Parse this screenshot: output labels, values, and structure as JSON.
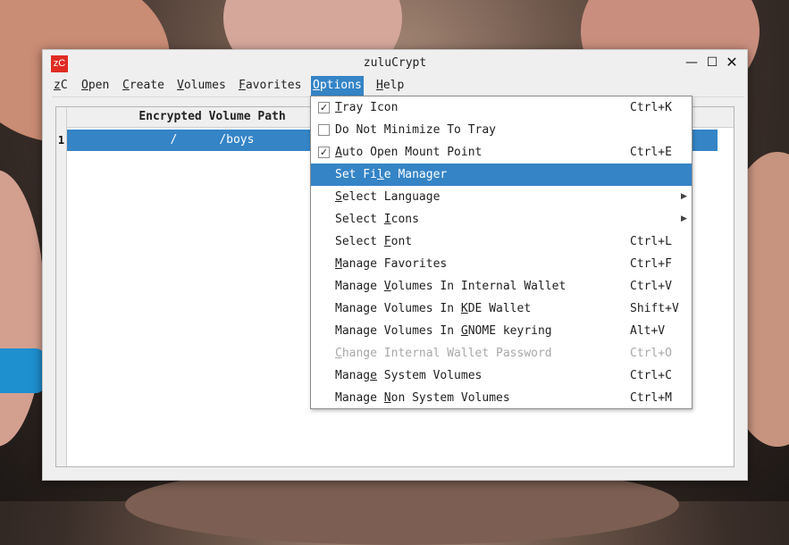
{
  "window": {
    "title": "zuluCrypt",
    "app_icon_text": "zC",
    "controls": {
      "minimize": "—",
      "maximize": "☐",
      "close": "✕"
    }
  },
  "menubar": {
    "items": [
      {
        "label": "zC",
        "mnemonic": "z"
      },
      {
        "label": "Open",
        "mnemonic": "O"
      },
      {
        "label": "Create",
        "mnemonic": "C"
      },
      {
        "label": "Volumes",
        "mnemonic": "V"
      },
      {
        "label": "Favorites",
        "mnemonic": "F"
      },
      {
        "label": "Options",
        "mnemonic": "O",
        "active": true
      },
      {
        "label": "Help",
        "mnemonic": "H"
      }
    ]
  },
  "table": {
    "header": "Encrypted Volume Path",
    "rows": [
      {
        "num": "1",
        "path": "/      /boys",
        "selected": true
      }
    ]
  },
  "options_menu": {
    "items": [
      {
        "pre": "",
        "u": "T",
        "post": "ray Icon",
        "shortcut": "Ctrl+K",
        "checkbox": true,
        "checked": true
      },
      {
        "pre": "Do Not Minimize To Tray",
        "u": "",
        "post": "",
        "shortcut": "",
        "checkbox": true,
        "checked": false
      },
      {
        "pre": "",
        "u": "A",
        "post": "uto Open Mount Point",
        "shortcut": "Ctrl+E",
        "checkbox": true,
        "checked": true
      },
      {
        "pre": "Set Fi",
        "u": "l",
        "post": "e Manager",
        "shortcut": "",
        "highlight": true
      },
      {
        "pre": "",
        "u": "S",
        "post": "elect Language",
        "shortcut": "",
        "submenu": true
      },
      {
        "pre": "Select ",
        "u": "I",
        "post": "cons",
        "shortcut": "",
        "submenu": true
      },
      {
        "pre": "Select ",
        "u": "F",
        "post": "ont",
        "shortcut": "Ctrl+L"
      },
      {
        "pre": "",
        "u": "M",
        "post": "anage Favorites",
        "shortcut": "Ctrl+F"
      },
      {
        "pre": "Manage ",
        "u": "V",
        "post": "olumes In Internal Wallet",
        "shortcut": "Ctrl+V"
      },
      {
        "pre": "Manage Volumes In ",
        "u": "K",
        "post": "DE Wallet",
        "shortcut": "Shift+V"
      },
      {
        "pre": "Manage Volumes In ",
        "u": "G",
        "post": "NOME keyring",
        "shortcut": "Alt+V"
      },
      {
        "pre": "",
        "u": "C",
        "post": "hange Internal Wallet Password",
        "shortcut": "Ctrl+O",
        "disabled": true
      },
      {
        "pre": "Manag",
        "u": "e",
        "post": " System Volumes",
        "shortcut": "Ctrl+C"
      },
      {
        "pre": "Manage ",
        "u": "N",
        "post": "on System Volumes",
        "shortcut": "Ctrl+M"
      }
    ],
    "check_mark": "✓",
    "submenu_arrow": "▶"
  },
  "colors": {
    "accent": "#3484c6",
    "app_icon": "#e02c23"
  }
}
